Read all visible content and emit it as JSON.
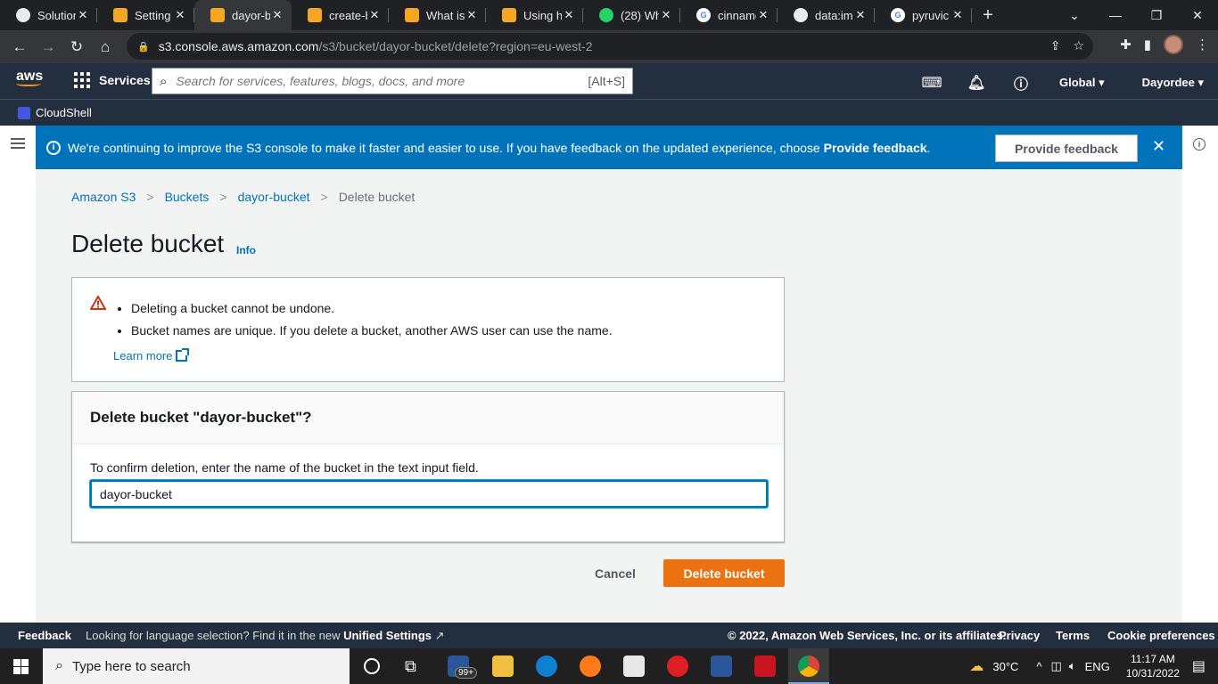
{
  "browser": {
    "tabs": [
      {
        "title": "Solution",
        "icon": "github-icon",
        "color": "#e8eaed"
      },
      {
        "title": "Setting",
        "icon": "aws-box-icon",
        "color": "#f5a623"
      },
      {
        "title": "dayor-b",
        "icon": "aws-box-icon",
        "color": "#f5a623",
        "active": true
      },
      {
        "title": "create-b",
        "icon": "aws-box-icon",
        "color": "#f5a623"
      },
      {
        "title": "What is",
        "icon": "aws-box-icon",
        "color": "#f5a623"
      },
      {
        "title": "Using hi",
        "icon": "aws-box-icon",
        "color": "#f5a623"
      },
      {
        "title": "(28) Wh",
        "icon": "whatsapp-icon",
        "color": "#25d366"
      },
      {
        "title": "cinnamo",
        "icon": "google-icon",
        "color": "#ffffff"
      },
      {
        "title": "data:ima",
        "icon": "globe-icon",
        "color": "#e8eaed"
      },
      {
        "title": "pyruvic",
        "icon": "google-icon",
        "color": "#ffffff"
      }
    ],
    "url_host": "s3.console.aws.amazon.com",
    "url_path": "/s3/bucket/dayor-bucket/delete?region=eu-west-2"
  },
  "awsnav": {
    "services_label": "Services",
    "search_placeholder": "Search for services, features, blogs, docs, and more",
    "search_shortcut": "[Alt+S]",
    "region": "Global ▾",
    "user": "Dayordee ▾",
    "cloudshell_label": "CloudShell"
  },
  "flash": {
    "message": "We're continuing to improve the S3 console to make it faster and easier to use. If you have feedback on the updated experience, choose ",
    "message_bold": "Provide feedback",
    "message_end": ".",
    "button_label": "Provide feedback"
  },
  "breadcrumb": {
    "items": [
      "Amazon S3",
      "Buckets",
      "dayor-bucket"
    ],
    "current": "Delete bucket"
  },
  "page": {
    "title": "Delete bucket",
    "info_label": "Info"
  },
  "warning": {
    "items": [
      "Deleting a bucket cannot be undone.",
      "Bucket names are unique. If you delete a bucket, another AWS user can use the name."
    ],
    "learn_more": "Learn more"
  },
  "confirm": {
    "heading": "Delete bucket \"dayor-bucket\"?",
    "description": "To confirm deletion, enter the name of the bucket in the text input field.",
    "input_value": "dayor-bucket"
  },
  "actions": {
    "cancel_label": "Cancel",
    "delete_label": "Delete bucket"
  },
  "footer": {
    "feedback": "Feedback",
    "lang_text": "Looking for language selection? Find it in the new ",
    "lang_link": "Unified Settings",
    "copyright": "© 2022, Amazon Web Services, Inc. or its affiliates.",
    "links": [
      "Privacy",
      "Terms",
      "Cookie preferences"
    ]
  },
  "taskbar": {
    "search_placeholder": "Type here to search",
    "mail_badge": "99+",
    "weather": "30°C",
    "language": "ENG",
    "time": "11:17 AM",
    "date": "10/31/2022"
  },
  "colors": {
    "aws_nav": "#232f3e",
    "flash_blue": "#0073bb",
    "delete_orange": "#ec7211",
    "link_blue": "#0073bb"
  }
}
